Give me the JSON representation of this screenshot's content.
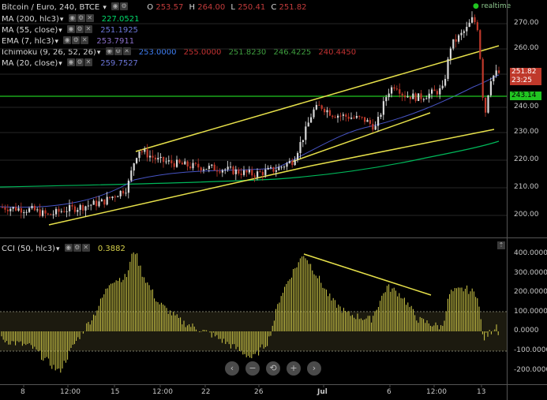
{
  "header": {
    "symbol_label": "Bitcoin / Euro, 240, BTCE",
    "ohlc": {
      "o_label": "O",
      "o": "253.57",
      "h_label": "H",
      "h": "264.00",
      "l_label": "L",
      "l": "250.41",
      "c_label": "C",
      "c": "251.82"
    },
    "realtime_label": "realtime"
  },
  "indicators": [
    {
      "label": "MA (200, hlc3)",
      "value": "227.0521",
      "color": "#00d86a"
    },
    {
      "label": "MA (55, close)",
      "value": "251.1925",
      "color": "#5f6dd8"
    },
    {
      "label": "EMA (7, hlc3)",
      "value": "253.7911",
      "color": "#7f5fb8"
    },
    {
      "label": "Ichimoku (9, 26, 52, 26)",
      "values": [
        "253.0000",
        "255.0000",
        "251.8230",
        "246.4225",
        "240.4450"
      ],
      "colors": [
        "#3f7ff5",
        "#c63232",
        "#3fa03f",
        "#3fa03f",
        "#c63232"
      ]
    },
    {
      "label": "MA (20, close)",
      "value": "259.7527",
      "color": "#5f6dd8"
    }
  ],
  "price_axis": {
    "ticks": [
      "270.00",
      "260.00",
      "250.00",
      "240.00",
      "230.00",
      "220.00",
      "210.00",
      "200.00"
    ],
    "last_price_tag": "251.82",
    "countdown_tag": "23:25",
    "level_tag": "243.14"
  },
  "cci": {
    "label": "CCI (50, hlc3)",
    "value": "0.3882",
    "ticks": [
      "400.0000",
      "300.0000",
      "200.0000",
      "100.0000",
      "0.0000",
      "-100.0000",
      "-200.0000"
    ]
  },
  "time_axis": [
    "8",
    "12:00",
    "15",
    "12:00",
    "22",
    "26",
    "Jul",
    "6",
    "12:00",
    "13"
  ],
  "colors": {
    "up": "#e8e8e8",
    "down": "#c0392b",
    "trend": "#e6e04a",
    "hline": "#21c521",
    "cci": "#d6cf4a"
  },
  "nav": {
    "back": "‹",
    "minus": "−",
    "reset": "⟲",
    "plus": "+",
    "forward": "›"
  }
}
